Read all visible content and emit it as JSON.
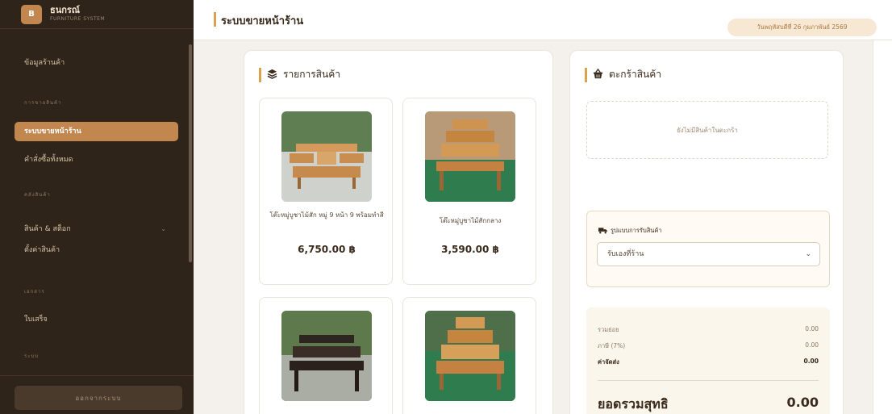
{
  "brand": {
    "logo_letter": "B",
    "name": "ธนกรณ์",
    "subtitle": "FURNITURE SYSTEM"
  },
  "sidebar": {
    "items": [
      {
        "label": "ข้อมูลร้านค้า"
      },
      {
        "section": "การขายสินค้า"
      },
      {
        "label": "ระบบขายหน้าร้าน",
        "active": true
      },
      {
        "label": "คำสั่งซื้อทั้งหมด"
      },
      {
        "section": "คลังสินค้า"
      },
      {
        "label": "สินค้า & สต็อก"
      },
      {
        "label": "ตั้งค่าสินค้า"
      },
      {
        "section": "เอกสาร"
      },
      {
        "label": "ใบเสร็จ"
      },
      {
        "section": "ระบบ"
      }
    ],
    "logout_label": "ออกจากระบบ"
  },
  "header": {
    "title": "ระบบขายหน้าร้าน",
    "date": "วันพฤหัสบดีที่ 26 กุมภาพันธ์ 2569"
  },
  "products": {
    "title": "รายการสินค้า",
    "items": [
      {
        "name": "โต๊ะหมู่บูชาไม้สัก หมู่ 9 หน้า 9 พร้อมทำสี",
        "price": "6,750.00 ฿"
      },
      {
        "name": "โต๊ะหมู่บูชาไม้สักกลาง",
        "price": "3,590.00 ฿"
      },
      {
        "name": "",
        "price": ""
      },
      {
        "name": "",
        "price": ""
      }
    ]
  },
  "cart": {
    "title": "ตะกร้าสินค้า",
    "empty": "ยังไม่มีสินค้าในตะกร้า",
    "delivery_label": "รูปแบบการรับสินค้า",
    "delivery_value": "รับเองที่ร้าน",
    "summary": {
      "subtotal_label": "รวมย่อย",
      "subtotal": "0.00",
      "vat_label": "ภาษี (7%)",
      "vat": "0.00",
      "shipping_label": "ค่าจัดส่ง",
      "shipping": "0.00",
      "total_label": "ยอดรวมสุทธิ",
      "total": "0.00"
    }
  },
  "colors": {
    "accent": "#c2874f",
    "sidebar_bg": "#2f241a",
    "gold": "#d9a24d"
  }
}
